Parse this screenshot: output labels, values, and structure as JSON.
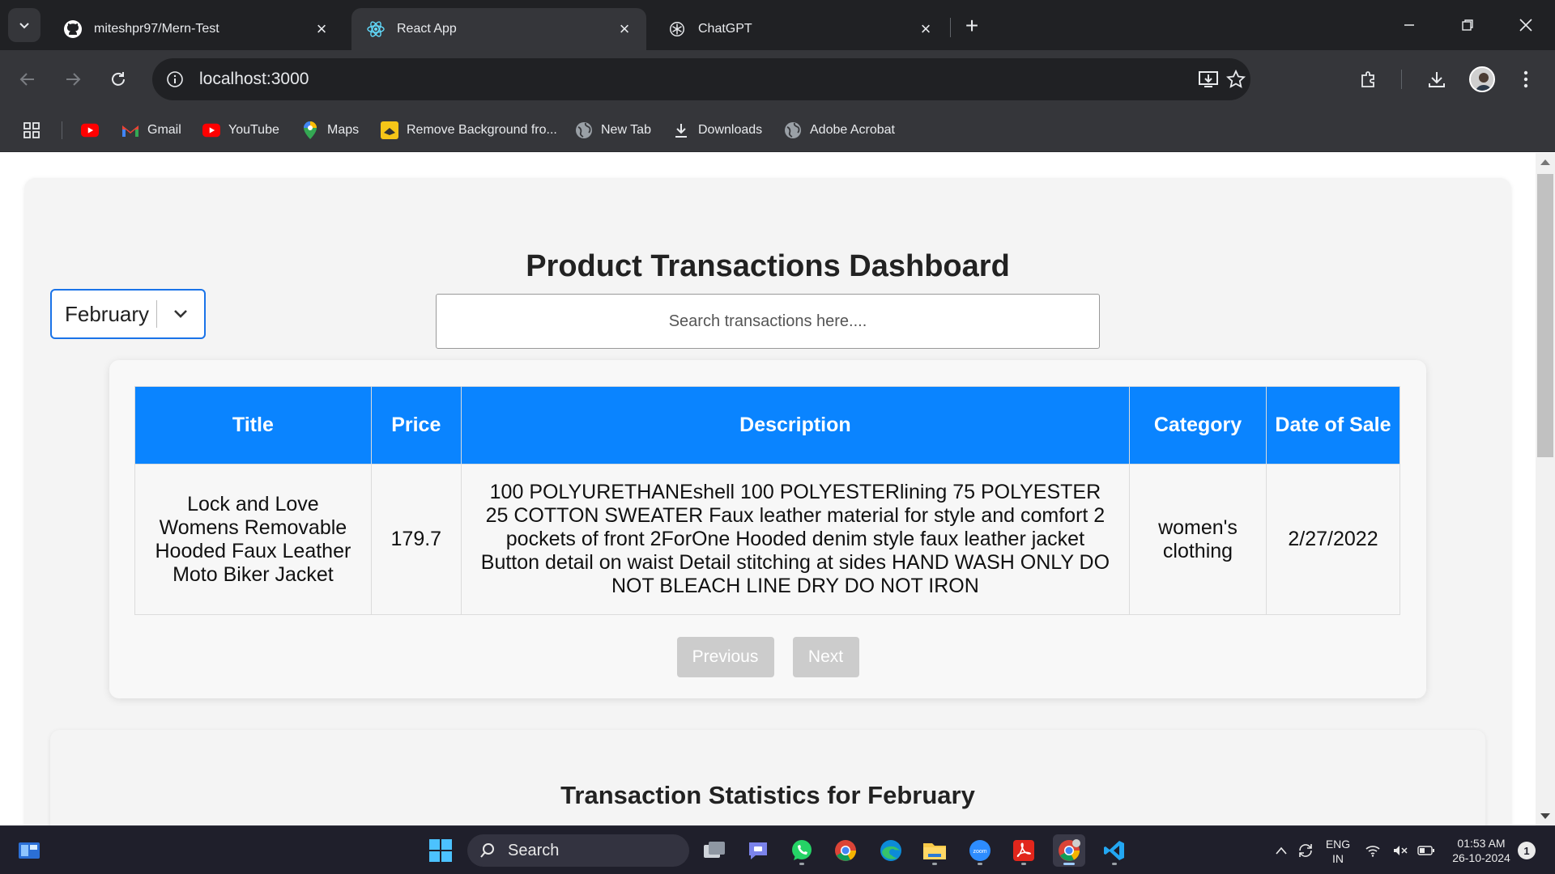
{
  "browser": {
    "tabs": [
      {
        "title": "miteshpr97/Mern-Test",
        "icon": "github-icon",
        "active": false
      },
      {
        "title": "React App",
        "icon": "react-icon",
        "active": true
      },
      {
        "title": "ChatGPT",
        "icon": "chatgpt-icon",
        "active": false
      }
    ],
    "url": "localhost:3000",
    "bookmarks": [
      {
        "label": "",
        "icon": "youtube-icon"
      },
      {
        "label": "Gmail",
        "icon": "gmail-icon"
      },
      {
        "label": "YouTube",
        "icon": "youtube-icon"
      },
      {
        "label": "Maps",
        "icon": "maps-icon"
      },
      {
        "label": "Remove Background fro...",
        "icon": "remove-bg-icon"
      },
      {
        "label": "New Tab",
        "icon": "globe-icon"
      },
      {
        "label": "Downloads",
        "icon": "download-icon"
      },
      {
        "label": "Adobe Acrobat",
        "icon": "globe-icon"
      }
    ]
  },
  "dashboard": {
    "title": "Product Transactions Dashboard",
    "month_selected": "February",
    "search_placeholder": "Search transactions here....",
    "table": {
      "headers": [
        "Title",
        "Price",
        "Description",
        "Category",
        "Date of Sale"
      ],
      "rows": [
        {
          "title": "Lock and Love Womens Removable Hooded Faux Leather Moto Biker Jacket",
          "price": "179.7",
          "description": "100 POLYURETHANEshell 100 POLYESTERlining 75 POLYESTER 25 COTTON SWEATER Faux leather material for style and comfort 2 pockets of front 2ForOne Hooded denim style faux leather jacket Button detail on waist Detail stitching at sides HAND WASH ONLY DO NOT BLEACH LINE DRY DO NOT IRON",
          "category": "women's clothing",
          "date_of_sale": "2/27/2022"
        }
      ]
    },
    "pagination": {
      "previous_label": "Previous",
      "next_label": "Next"
    },
    "stats_title": "Transaction Statistics for February"
  },
  "taskbar": {
    "search_label": "Search",
    "language": "ENG",
    "region": "IN",
    "time": "01:53 AM",
    "date": "26-10-2024",
    "notification_count": "1"
  },
  "colors": {
    "accent": "#0a84ff",
    "select_border": "#1a73e8",
    "button_disabled": "#cccccc"
  }
}
